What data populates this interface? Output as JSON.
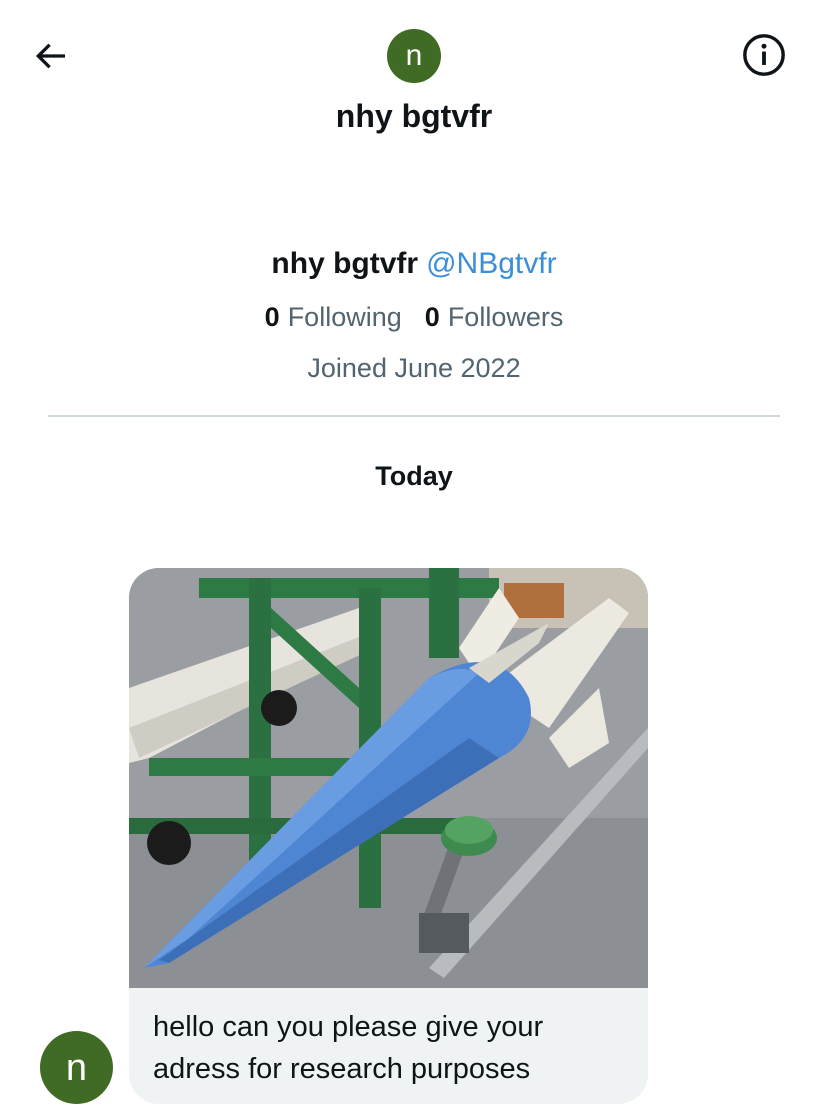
{
  "header": {
    "avatar_letter": "n",
    "title": "nhy bgtvfr"
  },
  "profile": {
    "name": "nhy bgtvfr",
    "handle": "@NBgtvfr",
    "following_count": "0",
    "following_label": "Following",
    "followers_count": "0",
    "followers_label": "Followers",
    "joined": "Joined June 2022"
  },
  "conversation": {
    "date_separator": "Today",
    "messages": [
      {
        "sender_avatar_letter": "n",
        "text": "hello can you please give your adress for research purposes",
        "has_media": true
      }
    ]
  },
  "icons": {
    "back": "arrow-left-icon",
    "info": "info-circle-icon"
  },
  "colors": {
    "avatar_bg": "#3f6b25",
    "handle": "#3b8fd9",
    "muted_text": "#536471",
    "bubble_bg": "#eff3f4",
    "divider": "#cfd9de"
  }
}
